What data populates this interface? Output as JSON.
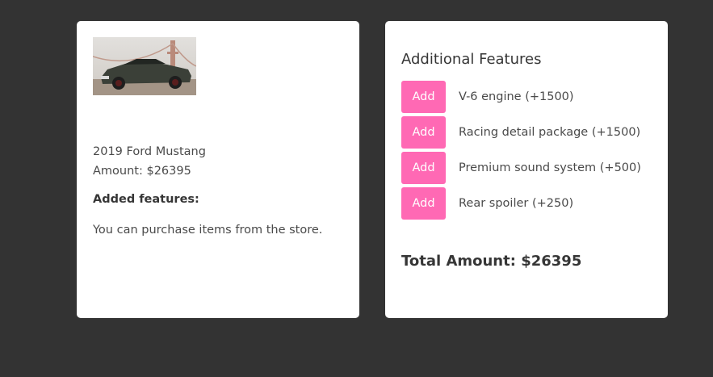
{
  "car": {
    "image_alt": "2019 Ford Mustang",
    "name": "2019 Ford Mustang",
    "amount_text": "Amount: $26395",
    "added_features_heading": "Added features:",
    "added_features_empty": "You can purchase items from the store."
  },
  "store": {
    "title": "Additional Features",
    "features": [
      {
        "button_label": "Add",
        "label": "V-6 engine (+1500)"
      },
      {
        "button_label": "Add",
        "label": "Racing detail package (+1500)"
      },
      {
        "button_label": "Add",
        "label": "Premium sound system (+500)"
      },
      {
        "button_label": "Add",
        "label": "Rear spoiler (+250)"
      }
    ]
  },
  "total": {
    "text": "Total Amount: $26395"
  },
  "colors": {
    "background": "#333333",
    "card": "#ffffff",
    "accent": "#ff69b4"
  }
}
